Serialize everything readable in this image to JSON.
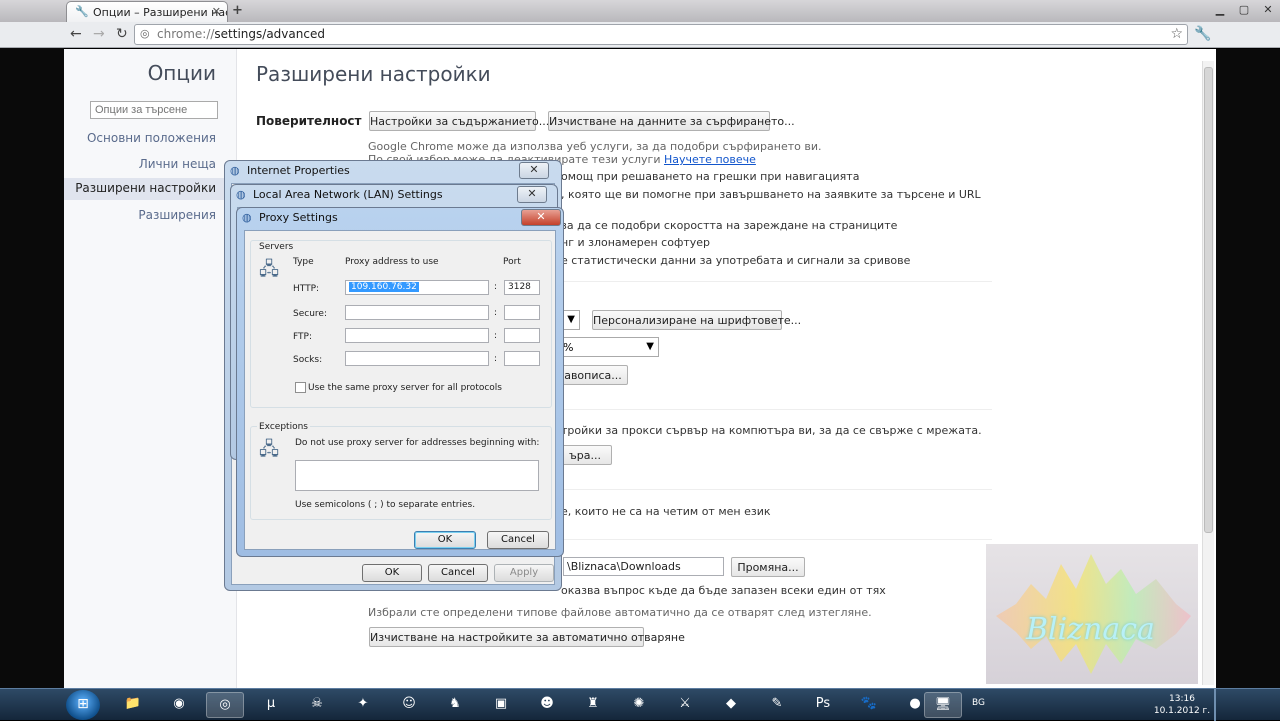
{
  "browser": {
    "tab_title": "Опции – Разширени настр",
    "new_tab": "+",
    "url_scheme": "chrome://",
    "url_path": "settings/advanced",
    "window_controls": [
      "▁",
      "▢",
      "✕"
    ]
  },
  "sidebar": {
    "title": "Опции",
    "search_placeholder": "Опции за търсене",
    "items": [
      {
        "label": "Основни положения"
      },
      {
        "label": "Лични неща"
      },
      {
        "label": "Разширени настройки"
      },
      {
        "label": "Разширения"
      }
    ]
  },
  "main": {
    "title": "Разширени настройки",
    "privacy_label": "Поверителност",
    "content_settings_button": "Настройки за съдържанието...",
    "clear_data_button": "Изчистване на данните за сърфирането...",
    "google_services_text": "Google Chrome може да използва уеб услуги, за да подобри сърфирането ви.",
    "optout_text": "По свой избор може да деактивирате тези услуги",
    "learn_more": "Научете повече",
    "lines": [
      "омощ при решаването на грешки при навигацията",
      ", която ще ви помогне при завършването на заявките за търсене и URL",
      "за да се подобри скоростта на зареждане на страниците",
      "нг и злонамерен софтуер",
      "е статистически данни за употребата и сигнали за сривове"
    ],
    "customize_fonts_button": "Персонализиране на шрифтовете...",
    "zoom_value": "%",
    "encoding_button_partial": "авописа...",
    "proxy_text": "тройки за прокси сървър на компютъра ви, за да се свърже с мрежата.",
    "proxy_button_partial": "ъра...",
    "translate_text": "е, които не са на четим от мен език",
    "downloads_path": "\\Bliznaca\\Downloads",
    "change_button": "Промяна...",
    "ask_text": "оказва въпрос къде да бъде запазен всеки един от тях",
    "auto_open_text": "Избрали сте определени типове файлове автоматично да се отварят след изтегляне.",
    "reset_auto_open_button": "Изчистване на настройките за автоматично отваряне"
  },
  "internet_properties": {
    "title": "Internet Properties",
    "ok": "OK",
    "cancel": "Cancel",
    "apply": "Apply"
  },
  "lan_settings": {
    "title": "Local Area Network (LAN) Settings"
  },
  "proxy": {
    "title": "Proxy Settings",
    "servers_label": "Servers",
    "col_type": "Type",
    "col_address": "Proxy address to use",
    "col_port": "Port",
    "rows": [
      {
        "label": "HTTP:",
        "address": "109.160.76.32",
        "port": "3128"
      },
      {
        "label": "Secure:",
        "address": "",
        "port": ""
      },
      {
        "label": "FTP:",
        "address": "",
        "port": ""
      },
      {
        "label": "Socks:",
        "address": "",
        "port": ""
      }
    ],
    "colon": ":",
    "same_proxy_label": "Use the same proxy server for all protocols",
    "exceptions_label": "Exceptions",
    "exceptions_desc": "Do not use proxy server for addresses beginning with:",
    "semicolon_hint": "Use semicolons ( ; ) to separate entries.",
    "ok": "OK",
    "cancel": "Cancel"
  },
  "watermark": "Bliznaca",
  "taskbar": {
    "language": "BG",
    "time": "13:16",
    "date": "10.1.2012 г."
  },
  "colors": {
    "accent": "#1155cc",
    "dialog_title": "#b3c9e3",
    "taskbar": "#14263a"
  }
}
